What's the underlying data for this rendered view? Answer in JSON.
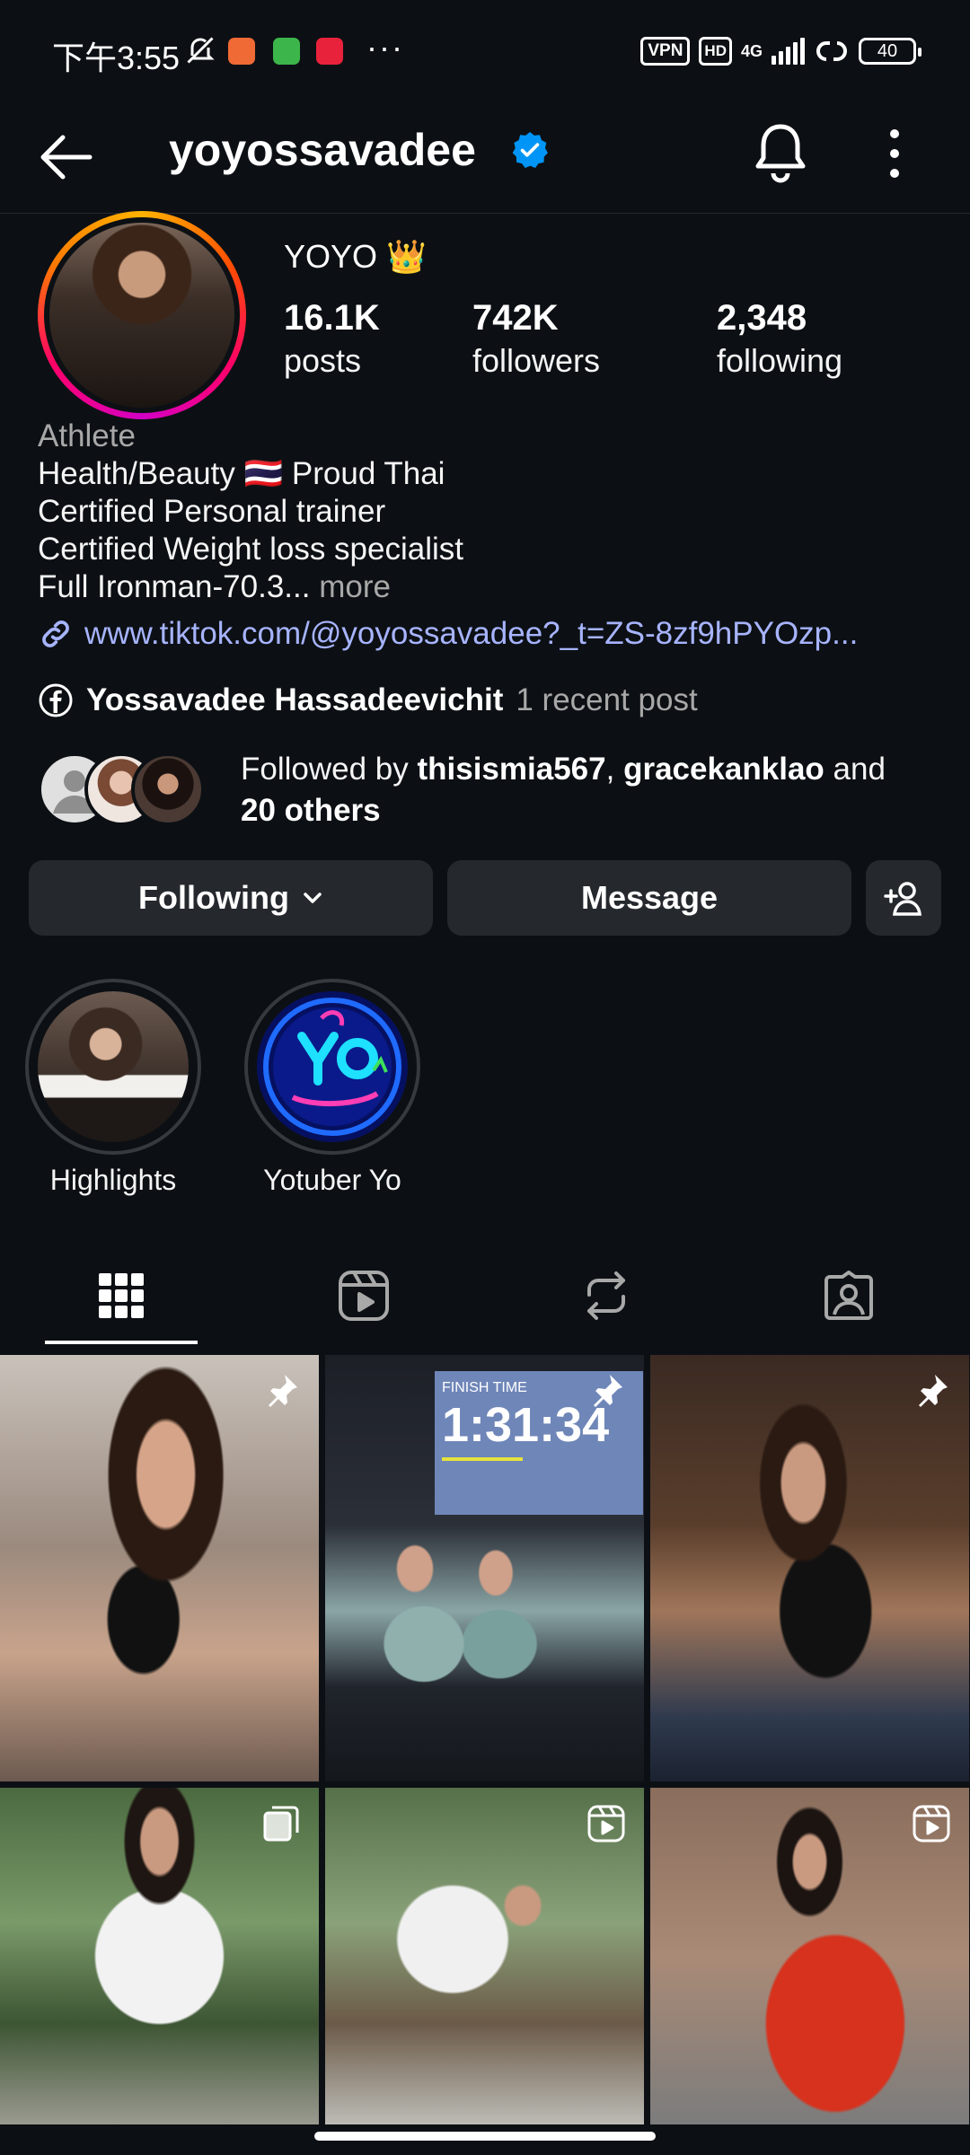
{
  "status_bar": {
    "time": "下午3:55",
    "dots": "···",
    "vpn": "VPN",
    "hd": "HD",
    "net": "4G",
    "battery": "40"
  },
  "header": {
    "username": "yoyossavadee"
  },
  "profile": {
    "display_name": "YOYO 👑",
    "stats": [
      {
        "value": "16.1K",
        "label": "posts"
      },
      {
        "value": "742K",
        "label": "followers"
      },
      {
        "value": "2,348",
        "label": "following"
      }
    ],
    "category": "Athlete",
    "bio_lines": [
      "Health/Beauty 🇹🇭 Proud Thai",
      "Certified Personal trainer",
      "Certified Weight loss specialist",
      "Full Ironman-70.3..."
    ],
    "more": " more",
    "link": "www.tiktok.com/@yoyossavadee?_t=ZS-8zf9hPYOzp...",
    "facebook_name": "Yossavadee Hassadeevichit",
    "facebook_recent": "1 recent post",
    "followed_by_prefix": "Followed by ",
    "followed_by_user1": "thisismia567",
    "followed_by_sep": ", ",
    "followed_by_user2": "gracekanklao",
    "followed_by_and": " and",
    "followed_by_others": "20 others"
  },
  "actions": {
    "following": "Following",
    "message": "Message"
  },
  "highlights": [
    {
      "label": "Highlights"
    },
    {
      "label": "Yotuber Yo"
    }
  ],
  "tabs": [
    {
      "name": "grid",
      "active": true
    },
    {
      "name": "reels",
      "active": false
    },
    {
      "name": "reposts",
      "active": false
    },
    {
      "name": "tagged",
      "active": false
    }
  ],
  "posts": [
    {
      "type": "pinned",
      "finish_label": "FINISH TIME",
      "finish_time": "1:31:34"
    }
  ],
  "colors": {
    "background": "#0c1014",
    "link": "#a7b4ff",
    "button": "#25292e",
    "verified": "#0095f6"
  }
}
